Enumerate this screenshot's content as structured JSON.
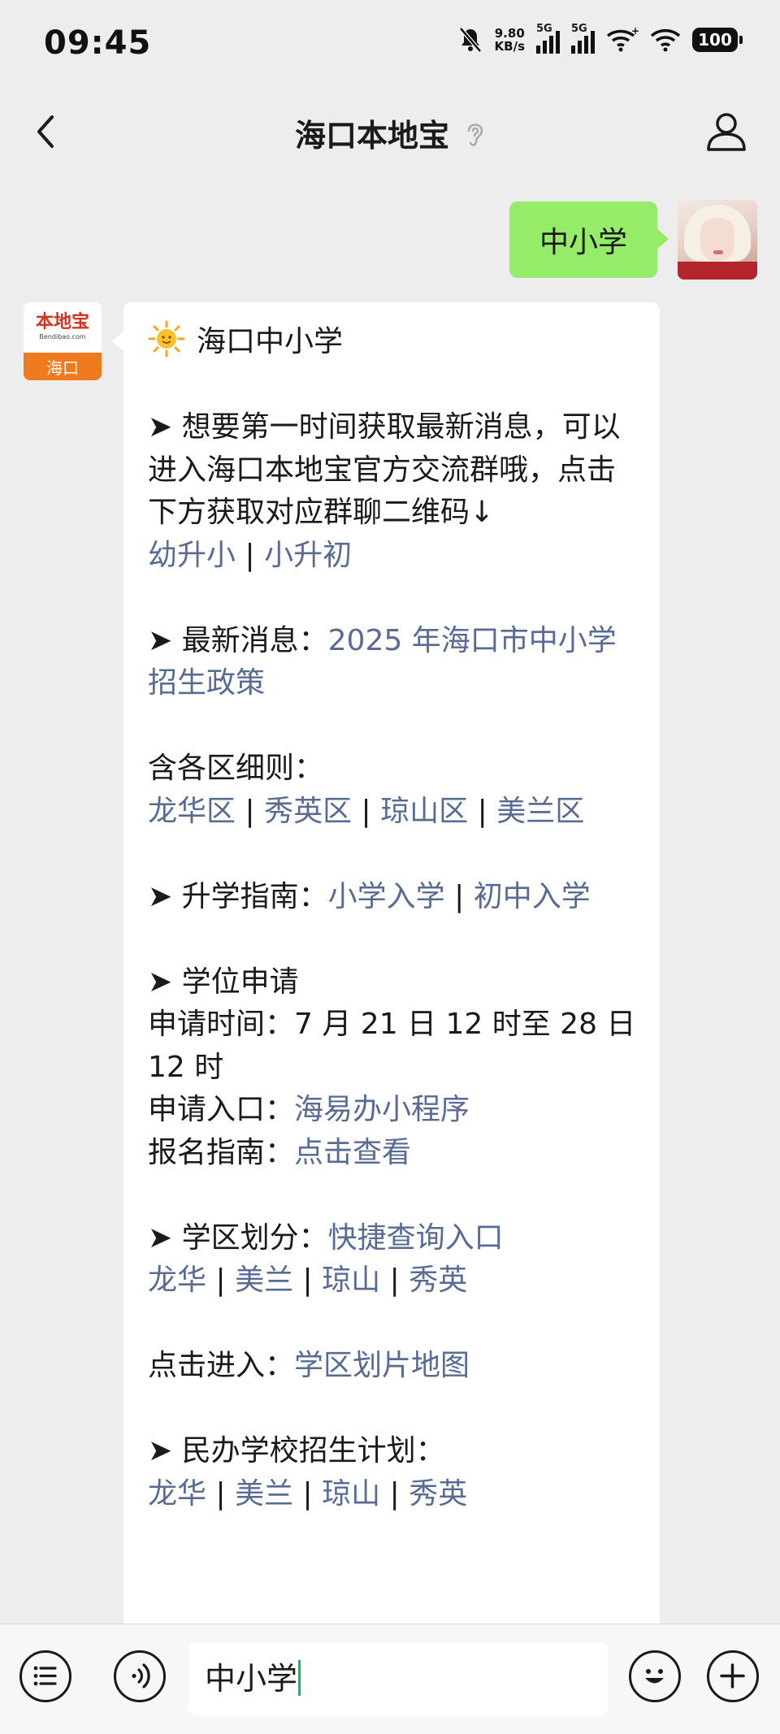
{
  "status_bar": {
    "time": "09:45",
    "net_speed_value": "9.80",
    "net_speed_unit": "KB/s",
    "signal1_label": "5G",
    "signal2_label": "5G",
    "battery": "100"
  },
  "nav": {
    "title": "海口本地宝",
    "icons": [
      "back-arrow-icon",
      "ear-icon",
      "profile-icon"
    ]
  },
  "conversation": {
    "user_message": "中小学",
    "bot_avatar": {
      "logo_text": "本地宝",
      "logo_url": "Bendibao.com",
      "city": "海口"
    },
    "bot_message": {
      "heading": "海口中小学",
      "arrow": "➤",
      "s1_line": "想要第一时间获取最新消息，可以进入海口本地宝官方交流群哦，点击下方获取对应群聊二维码↓",
      "s1_links": [
        "幼升小",
        "小升初"
      ],
      "s2_label": "最新消息：",
      "s2_link": "2025 年海口市中小学招生政策",
      "s3_label": "含各区细则：",
      "s3_links": [
        "龙华区",
        "秀英区",
        "琼山区",
        "美兰区"
      ],
      "s4_label": "升学指南：",
      "s4_links": [
        "小学入学",
        "初中入学"
      ],
      "s5_title": "学位申请",
      "s5_time": "申请时间：7 月 21 日 12 时至 28 日 12 时",
      "s5_entry_label": "申请入口：",
      "s5_entry_link": "海易办小程序",
      "s5_guide_label": "报名指南：",
      "s5_guide_link": "点击查看",
      "s6_label": "学区划分：",
      "s6_link": "快捷查询入口",
      "s6_links": [
        "龙华",
        "美兰",
        "琼山",
        "秀英"
      ],
      "s7_label": "点击进入：",
      "s7_link": "学区划片地图",
      "s8_label": "民办学校招生计划：",
      "s8_links": [
        "龙华",
        "美兰",
        "琼山",
        "秀英"
      ],
      "separator": "|"
    }
  },
  "input_bar": {
    "text": "中小学",
    "icons": [
      "menu-list-icon",
      "voice-icon",
      "emoji-icon",
      "plus-icon"
    ]
  },
  "colors": {
    "bubble_green": "#95ec69",
    "link": "#576b95",
    "background": "#ededed",
    "caret": "#07c160"
  }
}
